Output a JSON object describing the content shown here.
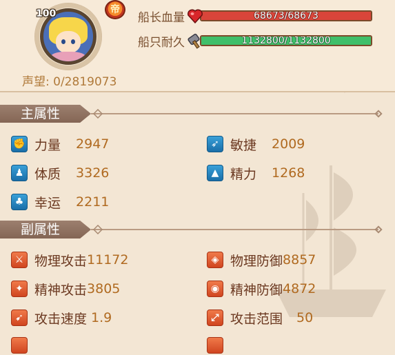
{
  "captain": {
    "level": "100",
    "rank_glyph": "帝",
    "fame_label": "声望:",
    "fame_value": "0/2819073"
  },
  "bars": {
    "hp": {
      "label": "船长血量",
      "text": "68673/68673",
      "fill": 1.0,
      "color": "#d9453a"
    },
    "durability": {
      "label": "船只耐久",
      "text": "1132800/1132800",
      "fill": 1.0,
      "color": "#3fbf6a"
    }
  },
  "main_section": {
    "title": "主属性",
    "items": [
      {
        "label": "力量",
        "value": "2947",
        "icon": "fist-icon"
      },
      {
        "label": "敏捷",
        "value": "2009",
        "icon": "wing-icon"
      },
      {
        "label": "体质",
        "value": "3326",
        "icon": "person-icon"
      },
      {
        "label": "精力",
        "value": "1268",
        "icon": "graduation-cap-icon"
      },
      {
        "label": "幸运",
        "value": "2211",
        "icon": "clover-icon"
      }
    ]
  },
  "sub_section": {
    "title": "副属性",
    "items": [
      {
        "label": "物理攻击",
        "value": "11172",
        "icon": "sword-icon"
      },
      {
        "label": "物理防御",
        "value": "8857",
        "icon": "shield-icon"
      },
      {
        "label": "精神攻击",
        "value": "3805",
        "icon": "staff-icon"
      },
      {
        "label": "精神防御",
        "value": "4872",
        "icon": "magic-shield-icon"
      },
      {
        "label": "攻击速度",
        "value": "1.9",
        "icon": "swift-sword-icon"
      },
      {
        "label": "攻击范围",
        "value": "50",
        "icon": "range-icon"
      }
    ]
  }
}
